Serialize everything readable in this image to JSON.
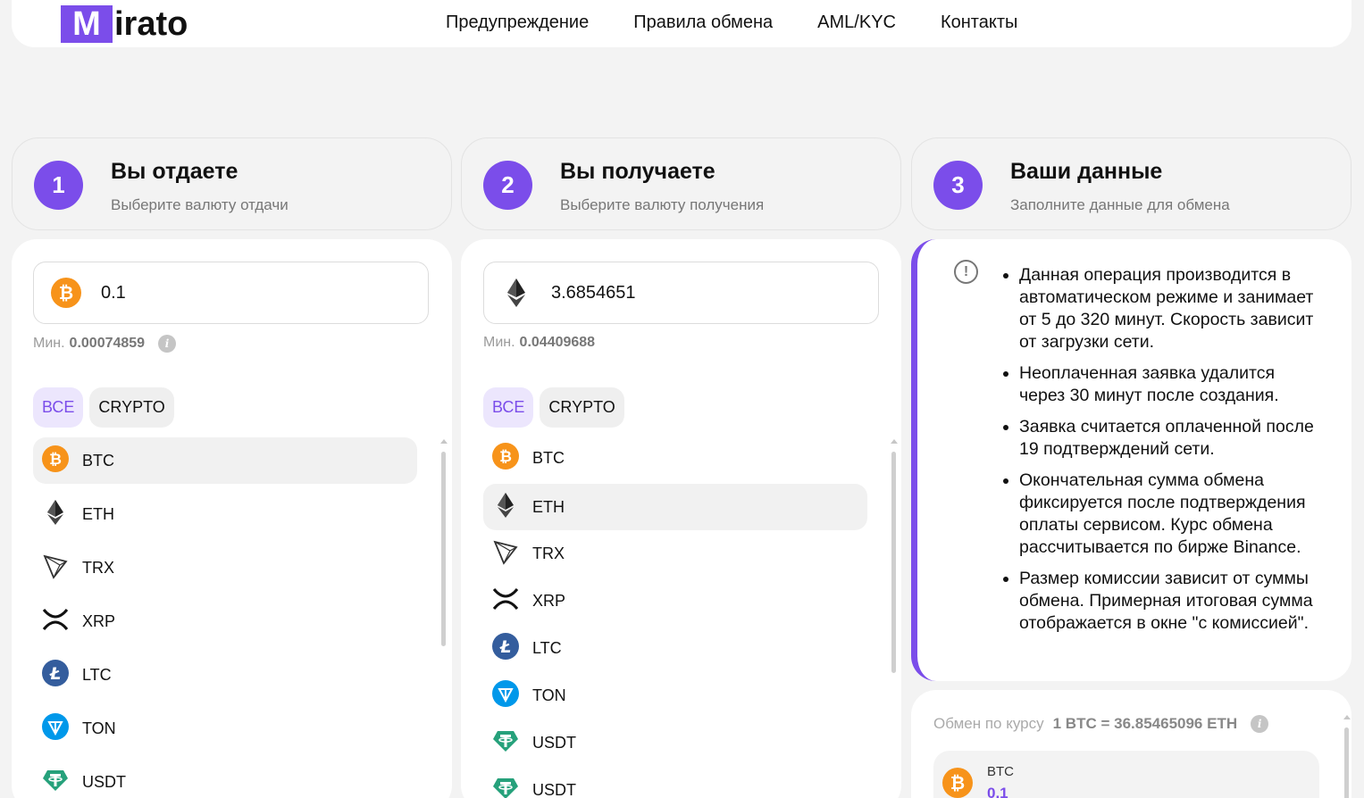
{
  "header": {
    "logo_letter": "M",
    "logo_rest": "irato",
    "nav": [
      "Предупреждение",
      "Правила обмена",
      "AML/KYC",
      "Контакты"
    ]
  },
  "steps": [
    {
      "num": "1",
      "title": "Вы отдаете",
      "sub": "Выберите валюту отдачи"
    },
    {
      "num": "2",
      "title": "Вы получаете",
      "sub": "Выберите валюту получения"
    },
    {
      "num": "3",
      "title": "Ваши данные",
      "sub": "Заполните данные для обмена"
    }
  ],
  "give": {
    "amount": "0.1",
    "min_label": "Мин.",
    "min_value": "0.00074859",
    "filters": [
      "ВСЕ",
      "CRYPTO"
    ],
    "coins": [
      "BTC",
      "ETH",
      "TRX",
      "XRP",
      "LTC",
      "TON",
      "USDT"
    ]
  },
  "get": {
    "amount": "3.6854651",
    "min_label": "Мин.",
    "min_value": "0.04409688",
    "filters": [
      "ВСЕ",
      "CRYPTO"
    ],
    "coins": [
      "BTC",
      "ETH",
      "TRX",
      "XRP",
      "LTC",
      "TON",
      "USDT",
      "USDT"
    ]
  },
  "notice": {
    "items": [
      "Данная операция производится в автоматическом режиме и занимает от 5 до 320 минут. Скорость зависит от загрузки сети.",
      "Неоплаченная заявка удалится через 30 минут после создания.",
      "Заявка считается оплаченной после 19 подтверждений сети.",
      "Окончательная сумма обмена фиксируется после подтверждения оплаты сервисом. Курс обмена рассчитывается по бирже Binance.",
      "Размер комиссии зависит от суммы обмена. Примерная итоговая сумма отображается в окне \"с комиссией\"."
    ]
  },
  "rate": {
    "label": "Обмен по курсу",
    "value": "1 BTC = 36.85465096 ETH",
    "summary_currency": "BTC",
    "summary_amount": "0.1"
  },
  "colors": {
    "accent": "#7b4dea",
    "btc": "#f7931a",
    "ltc": "#345d9d",
    "ton": "#0098ea",
    "usdt": "#26a17b"
  }
}
